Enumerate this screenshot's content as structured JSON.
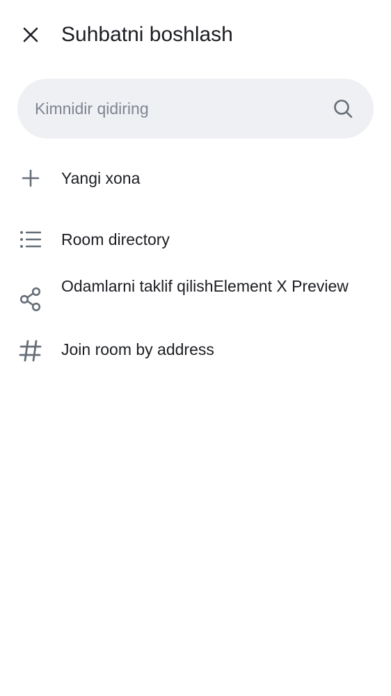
{
  "header": {
    "title": "Suhbatni boshlash",
    "close_icon": "close-icon"
  },
  "search": {
    "placeholder": "Kimnidir qidiring",
    "value": "",
    "icon": "search-icon"
  },
  "menu": {
    "items": [
      {
        "label": "Yangi xona",
        "icon": "plus-icon"
      },
      {
        "label": "Room directory",
        "icon": "list-icon"
      },
      {
        "label": "Odamlarni taklif qilishElement X Preview",
        "icon": "share-icon"
      },
      {
        "label": "Join room by address",
        "icon": "hash-icon"
      }
    ]
  },
  "colors": {
    "text": "#1b1d22",
    "icon": "#656d77",
    "search_bg": "#eff0f4",
    "placeholder": "#7e8590"
  }
}
